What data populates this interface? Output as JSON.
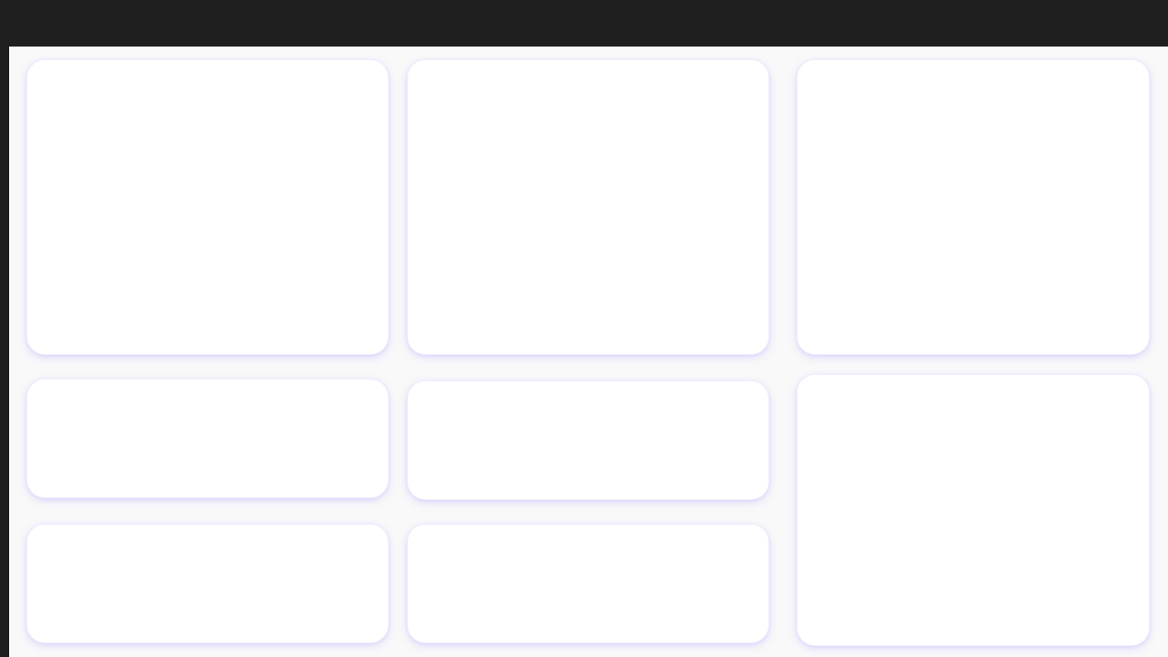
{
  "dashboard": {
    "cards": [
      {
        "id": "card-1",
        "title": ""
      },
      {
        "id": "card-2",
        "title": ""
      },
      {
        "id": "card-3",
        "title": ""
      },
      {
        "id": "card-4",
        "title": ""
      },
      {
        "id": "card-5",
        "title": ""
      },
      {
        "id": "card-6",
        "title": ""
      },
      {
        "id": "card-7",
        "title": ""
      },
      {
        "id": "card-8",
        "title": ""
      }
    ]
  }
}
